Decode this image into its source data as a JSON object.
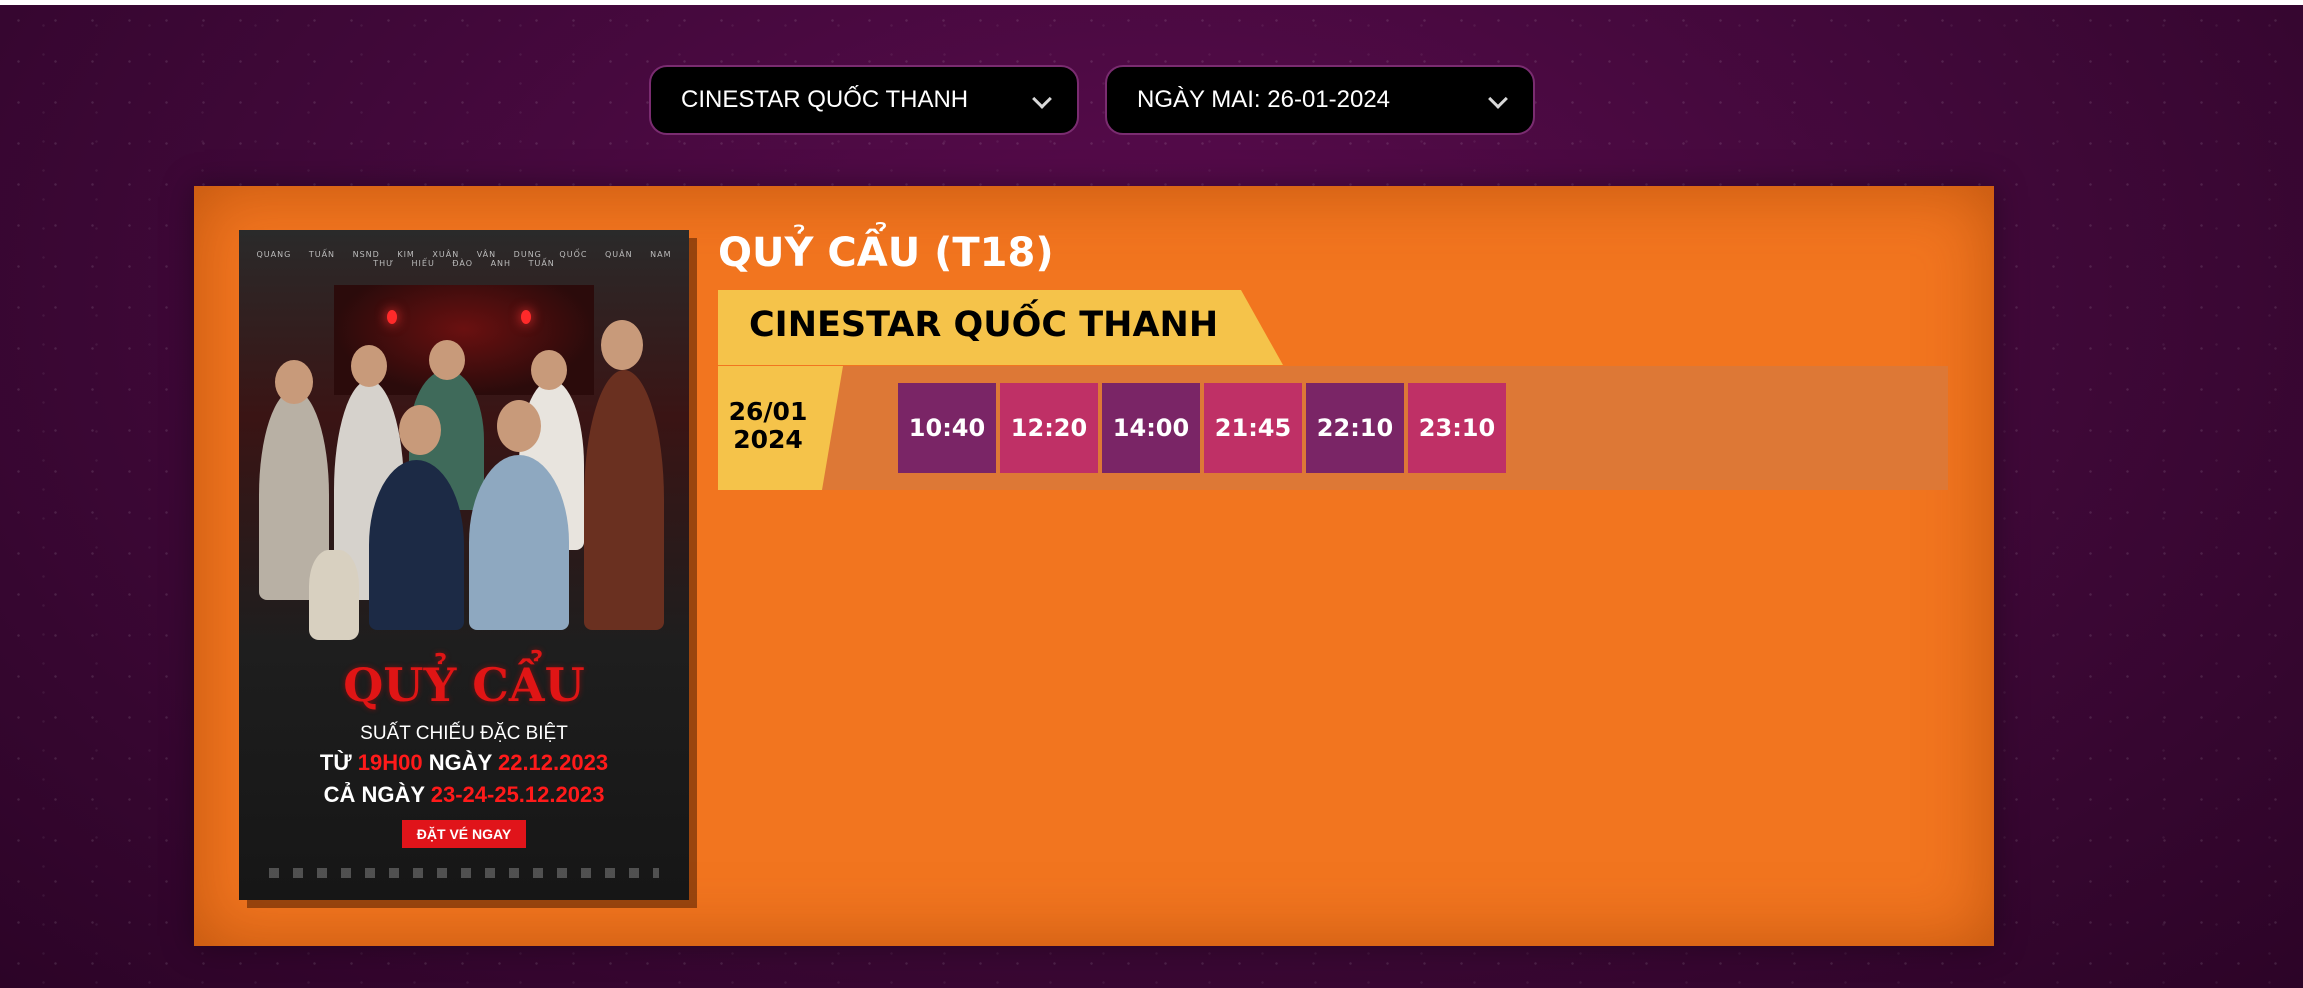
{
  "filters": {
    "cinema": {
      "value": "CINESTAR QUỐC THANH"
    },
    "date": {
      "value": "NGÀY MAI: 26-01-2024"
    }
  },
  "movie": {
    "title": "QUỶ CẨU (T18)",
    "poster": {
      "cast": "QUANG TUẤN NSND KIM XUÂN VÂN DUNG QUỐC QUÂN NAM THƯ HIẾU ĐÀO ANH TUẤN",
      "title": "QUỶ CẨU",
      "line1": "SUẤT CHIẾU ĐẶC BIỆT",
      "line2_a": "TỪ ",
      "line2_b": "19H00",
      "line2_c": " NGÀY ",
      "line2_d": "22.12.2023",
      "line3_a": "CẢ NGÀY ",
      "line3_b": "23-24-25.12.2023",
      "cta": "ĐẶT VÉ NGAY"
    }
  },
  "showtimes": {
    "cinema_name": "CINESTAR QUỐC THANH",
    "date_line1": "26/01",
    "date_line2": "2024",
    "times": [
      "10:40",
      "12:20",
      "14:00",
      "21:45",
      "22:10",
      "23:10"
    ]
  },
  "colors": {
    "card": "#f2751f",
    "label": "#f5c34a",
    "slot_dark": "#7a2566",
    "slot_light": "#bf3066"
  }
}
